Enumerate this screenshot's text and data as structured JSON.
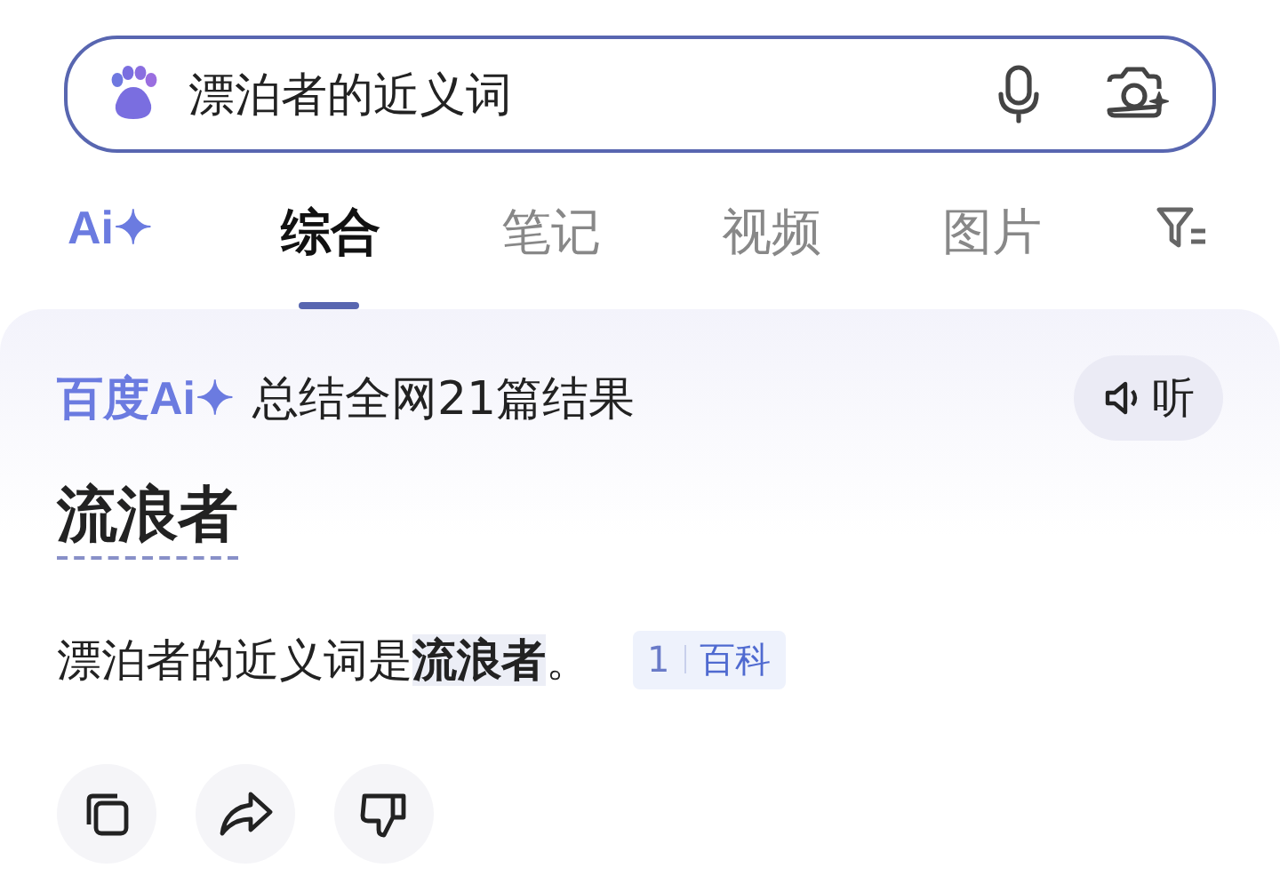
{
  "search": {
    "value": "漂泊者的近义词"
  },
  "ai_tab": {
    "label": "Ai✦"
  },
  "tabs": [
    {
      "label": "综合",
      "selected": true
    },
    {
      "label": "笔记",
      "selected": false
    },
    {
      "label": "视频",
      "selected": false
    },
    {
      "label": "图片",
      "selected": false
    }
  ],
  "answer": {
    "brand": "百度Ai✦",
    "summary": "总结全网21篇结果",
    "listen": "听",
    "headline": "流浪者",
    "sentence": "漂泊者的近义词是**流浪者**。",
    "citation": {
      "number": "1",
      "source": "百科"
    }
  }
}
